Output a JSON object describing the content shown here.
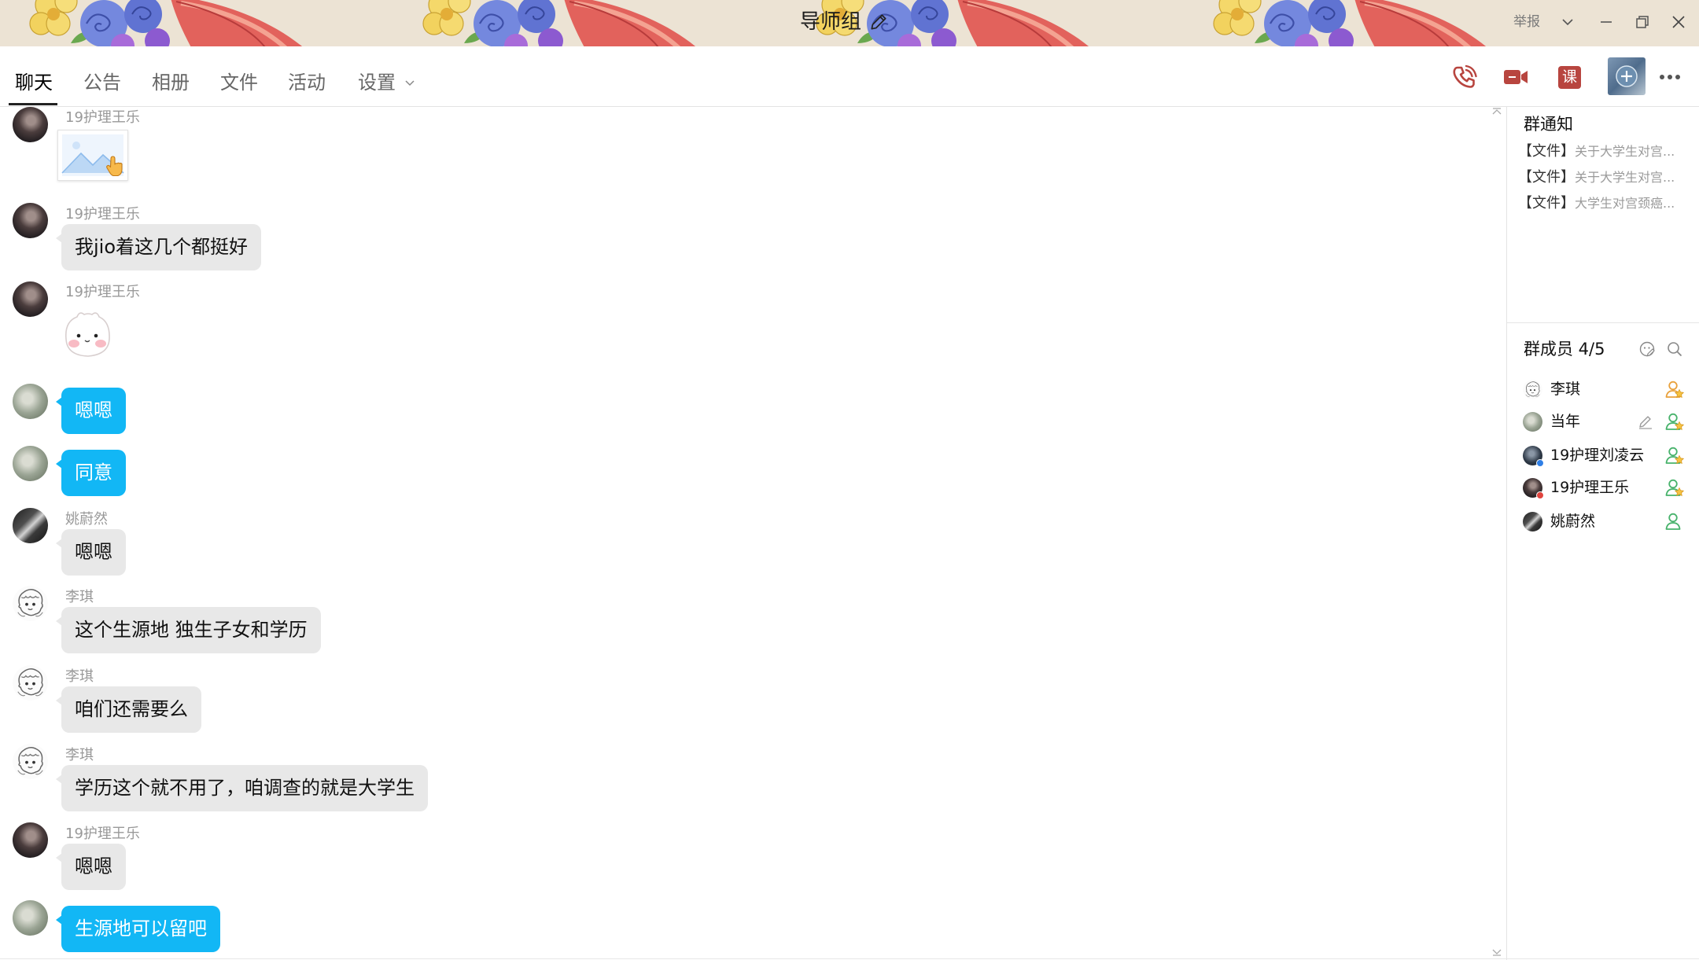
{
  "window": {
    "title": "导师组",
    "report_label": "举报"
  },
  "tabs": [
    {
      "label": "聊天",
      "active": true
    },
    {
      "label": "公告"
    },
    {
      "label": "相册"
    },
    {
      "label": "文件"
    },
    {
      "label": "活动"
    },
    {
      "label": "设置",
      "icon": "chevron-down-icon"
    }
  ],
  "toolbar": {
    "icons": [
      "phone-icon",
      "video-call-icon",
      "course-icon",
      "app-plus-icon",
      "more-icon"
    ],
    "course_label": "课"
  },
  "colors": {
    "self_bubble": "#12b7f5",
    "other_bubble": "#e8e8e8",
    "toolbar_icon": "#b8453f",
    "titlebar_bg": "#ece3d4"
  },
  "messages": [
    {
      "sender": "19护理王乐",
      "image_icon": "image-placeholder-icon"
    },
    {
      "sender": "19护理王乐",
      "text": "我jio着这几个都挺好"
    },
    {
      "sender": "19护理王乐",
      "sticker_icon": "bear-sticker-icon"
    },
    {
      "self": true,
      "text": "嗯嗯"
    },
    {
      "self": true,
      "text": "同意"
    },
    {
      "sender": "姚蔚然",
      "text": "嗯嗯"
    },
    {
      "sender": "李琪",
      "text": "这个生源地 独生子女和学历"
    },
    {
      "sender": "李琪",
      "text": "咱们还需要么"
    },
    {
      "sender": "李琪",
      "text": "学历这个就不用了，咱调查的就是大学生"
    },
    {
      "sender": "19护理王乐",
      "text": "嗯嗯"
    },
    {
      "self": true,
      "text": "生源地可以留吧"
    }
  ],
  "notices": {
    "title": "群通知",
    "items": [
      {
        "tag": "【文件】",
        "text": "关于大学生对宫..."
      },
      {
        "tag": "【文件】",
        "text": "关于大学生对宫..."
      },
      {
        "tag": "【文件】",
        "text": "大学生对宫颈癌..."
      }
    ]
  },
  "members": {
    "title": "群成员 4/5",
    "list": [
      {
        "name": "李琪",
        "role_icon": "owner-icon"
      },
      {
        "name": "当年",
        "role_icon": "admin-icon",
        "edit_icon": "edit-icon"
      },
      {
        "name": "19护理刘凌云",
        "role_icon": "admin-icon"
      },
      {
        "name": "19护理王乐",
        "role_icon": "admin-icon"
      },
      {
        "name": "姚蔚然",
        "role_icon": "member-icon"
      }
    ]
  }
}
